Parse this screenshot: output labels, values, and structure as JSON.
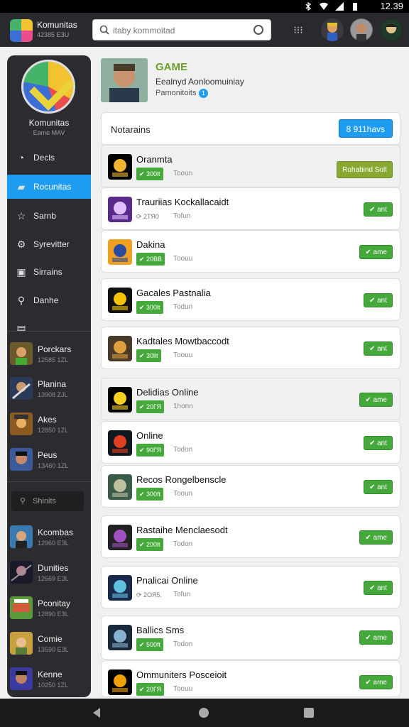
{
  "status": {
    "time": "12.39"
  },
  "app": {
    "title": "Komunitas",
    "subtitle": "42385 ЕЗU"
  },
  "search": {
    "placeholder": "itaby kommoitad"
  },
  "sidebar": {
    "title": "Komunitas",
    "subtitle": "Eame MAV",
    "nav": [
      {
        "label": "Decls",
        "icon": "users-icon"
      },
      {
        "label": "Rocunitas",
        "icon": "community-icon",
        "active": true
      },
      {
        "label": "Sarnb",
        "icon": "star-icon"
      },
      {
        "label": "Syrevitter",
        "icon": "share-icon"
      },
      {
        "label": "Sirrains",
        "icon": "image-icon"
      },
      {
        "label": "Danhe",
        "icon": "search-icon"
      }
    ],
    "friends_top": [
      {
        "name": "Porckars",
        "sub": "12585 1ZL"
      },
      {
        "name": "Planina",
        "sub": "13908 ZJL"
      },
      {
        "name": "Akes",
        "sub": "12850 1ZL"
      },
      {
        "name": "Peus",
        "sub": "1З460 1ZL"
      }
    ],
    "search_label": "Shinits",
    "friends_bottom": [
      {
        "name": "Kcombas",
        "sub": "12960 ЕЗL"
      },
      {
        "name": "Dunities",
        "sub": "12669 ЕЗL"
      },
      {
        "name": "Pconitay",
        "sub": "12890 ЕЗL"
      },
      {
        "name": "Comie",
        "sub": "13590 ЕЗL"
      },
      {
        "name": "Kenne",
        "sub": "10250 1ZL"
      }
    ]
  },
  "profile": {
    "tag": "GAME",
    "line1": "Eealnyd Aonloomuiniay",
    "line2": "Pamonitoits",
    "badge": "1"
  },
  "panel": {
    "title": "Notarains",
    "button": "8 911havs"
  },
  "games": [
    {
      "name": "Oranmta",
      "badge": "✔ 300lt",
      "time": "Tooun",
      "btn": "Rohabind Solt",
      "alt": true
    },
    {
      "name": "Trauriias Kockallacaidt",
      "badge": "⟳ 2ТЯ0",
      "time": "Tofun",
      "btn": "✔ ant",
      "plain": true
    },
    {
      "name": "Dakina",
      "badge": "✔ 20ВВ",
      "time": "Toouu",
      "btn": "✔ ame"
    },
    {
      "name": "Gacales Pastnalia",
      "badge": "✔ 300lt",
      "time": "Todun",
      "btn": "✔ ant"
    },
    {
      "name": "Kadtales Mowtbaccodt",
      "badge": "✔ 30llt",
      "time": "Toouu",
      "btn": "✔ ant"
    },
    {
      "name": "Delidias Online",
      "badge": "✔ 20ГЯ",
      "time": "1honn",
      "btn": "✔ ame",
      "alt": true
    },
    {
      "name": "Online",
      "badge": "✔ 90ГЯ",
      "time": "Todon",
      "btn": "✔ ant"
    },
    {
      "name": "Recos Rongelbenscle",
      "badge": "✔ 300ft",
      "time": "Tooun",
      "btn": "✔ ant"
    },
    {
      "name": "Rastaihe Menclaesodt",
      "badge": "✔ 200lt",
      "time": "Todon",
      "btn": "✔ ame"
    },
    {
      "name": "Pnalicai Online",
      "badge": "⟳ 2ОЯ5.",
      "time": "Tofun",
      "btn": "✔ ant",
      "plain": true
    },
    {
      "name": "Ballics Sms",
      "badge": "✔ 500ft",
      "time": "Todon",
      "btn": "✔ ame"
    },
    {
      "name": "Ommuniters Posceioit",
      "badge": "✔ 20ГЯ",
      "time": "Toouu",
      "btn": "✔ ame"
    }
  ],
  "colors": {
    "accent": "#1e9cf0",
    "green": "#44a83a",
    "dark": "#2c2c30"
  }
}
